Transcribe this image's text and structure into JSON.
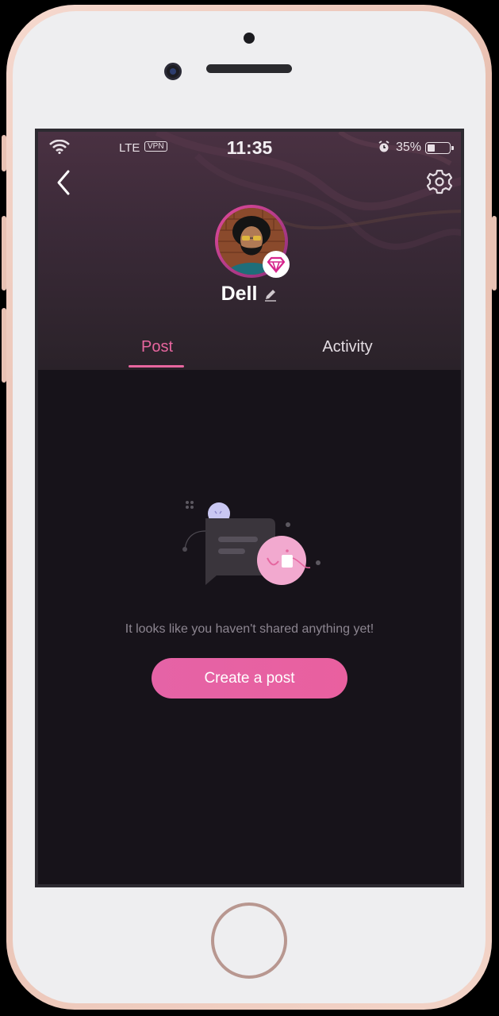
{
  "status_bar": {
    "network": "LTE",
    "vpn": "VPN",
    "time": "11:35",
    "battery_percent": "35%",
    "battery_level": 0.35
  },
  "header": {
    "back_icon": "chevron-left-icon",
    "settings_icon": "gear-icon"
  },
  "profile": {
    "name": "Dell",
    "badge_icon": "diamond-icon",
    "edit_icon": "pencil-icon"
  },
  "tabs": [
    {
      "label": "Post",
      "active": true
    },
    {
      "label": "Activity",
      "active": false
    }
  ],
  "empty_state": {
    "message": "It looks like you haven't shared anything yet!",
    "button_label": "Create a post"
  },
  "colors": {
    "accent": "#e8669f",
    "background": "#17131a",
    "header": "#3b2a38"
  }
}
